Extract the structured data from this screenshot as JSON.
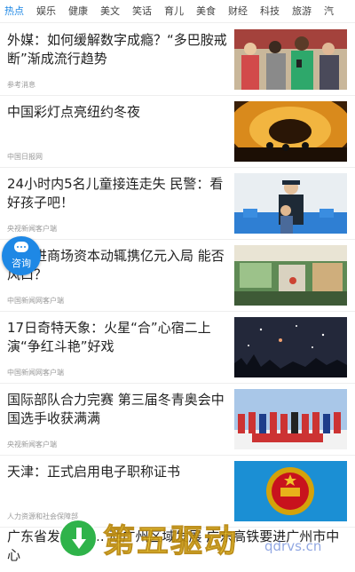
{
  "tabs": [
    "热点",
    "娱乐",
    "健康",
    "美文",
    "笑话",
    "育儿",
    "美食",
    "财经",
    "科技",
    "旅游",
    "汽"
  ],
  "news": [
    {
      "title": "外媒：如何缓解数字成瘾？“多巴胺戒断”渐成流行趋势",
      "source": "参考消息"
    },
    {
      "title": "中国彩灯点亮纽约冬夜",
      "source": "中国日报网"
    },
    {
      "title": "24小时内5名儿童接连走失 民警：看好孩子吧！",
      "source": "央视新闻客户端"
    },
    {
      "title": "国开进商场资本动辄携亿元入局 能否风口？",
      "source": "中国新闻网客户端"
    },
    {
      "title": "17日奇特天象：火星“合”心宿二上演“争红斗艳”好戏",
      "source": "中国新闻网客户端"
    },
    {
      "title": "国际部队合力完赛 第三届冬青奥会中国选手收获满满",
      "source": "央视新闻客户端"
    },
    {
      "title": "天津：正式启用电子职称证书",
      "source": "人力资源和社会保障部"
    }
  ],
  "last_title": "广东省发布 …… 动广州区域发展 广东高铁要进广州市中心",
  "consult_label": "咨询",
  "watermark": {
    "text": "第五驱动",
    "url": "qdrvs.cn"
  },
  "accent": "#1e88e5"
}
